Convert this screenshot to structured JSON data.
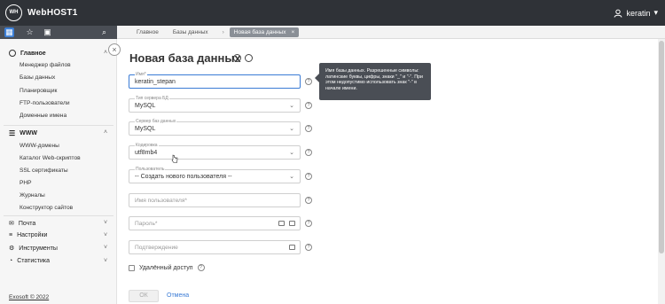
{
  "header": {
    "logo_text": "WH",
    "brand": "WebHOST1",
    "user": "keratin"
  },
  "breadcrumbs": [
    "Главное",
    "Базы данных",
    "Новая база данных"
  ],
  "sidebar": {
    "sections": [
      {
        "label": "Главное",
        "items": [
          "Менеджер файлов",
          "Базы данных",
          "Планировщик",
          "FTP-пользователи",
          "Доменные имена"
        ]
      },
      {
        "label": "WWW",
        "items": [
          "WWW-домены",
          "Каталог Web-скриптов",
          "SSL сертификаты",
          "PHP",
          "Журналы",
          "Конструктор сайтов"
        ]
      }
    ],
    "bottom": [
      "Почта",
      "Настройки",
      "Инструменты",
      "Статистика"
    ],
    "copyright": "Exosoft © 2022"
  },
  "form": {
    "title": "Новая база данных",
    "name": {
      "label": "Имя*",
      "value": "keratin_stepan"
    },
    "server_type": {
      "label": "Тип сервера БД",
      "value": "MySQL"
    },
    "server": {
      "label": "Сервер баз данных",
      "value": "MySQL"
    },
    "encoding": {
      "label": "Кодировка",
      "value": "utf8mb4"
    },
    "user": {
      "label": "Пользователь",
      "value": "-- Создать нового пользователя --"
    },
    "username": {
      "placeholder": "Имя пользователя*"
    },
    "password": {
      "placeholder": "Пароль*"
    },
    "confirm": {
      "placeholder": "Подтверждение"
    },
    "remote_access": "Удалённый доступ",
    "ok": "ОК",
    "cancel": "Отмена"
  },
  "tooltip": "Имя базы данных. Разрешенные символы: латинские буквы, цифры, знаки \"_\" и \"-\". При этом недопустимо использовать знак \"-\" в начале имени.",
  "help_mark": "?"
}
